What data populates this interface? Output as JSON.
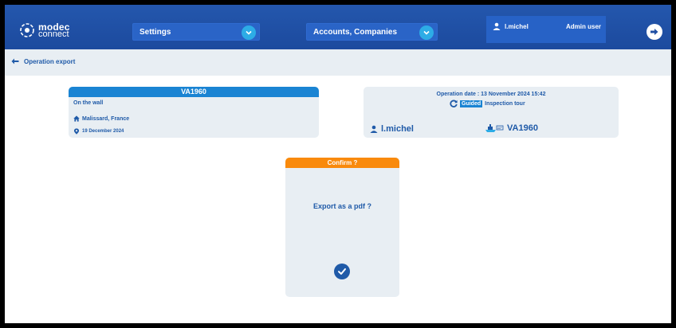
{
  "header": {
    "logo": {
      "top": "modec",
      "bottom": "connect"
    },
    "settings_select": "Settings",
    "accounts_select": "Accounts, Companies",
    "user": {
      "name": "l.michel",
      "role": "Admin user"
    }
  },
  "subbar": {
    "back_label": "Operation export"
  },
  "card1": {
    "title": "VA1960",
    "location_desc": "On the wall",
    "place": "Malissard, France",
    "date": "19 December 2024"
  },
  "card2": {
    "operation_date": "Operation date : 13 November 2024 15:42",
    "guided_badge": "Guided",
    "tour_type": "Inspection tour",
    "user": "l.michel",
    "boat_id": "VA1960"
  },
  "confirm": {
    "title": "Confirm ?",
    "question": "Export as a pdf ?"
  },
  "colors": {
    "header": "#1f4fa3",
    "accent_blue": "#1a84d3",
    "text_blue": "#1f5aa8",
    "orange": "#f98a0c",
    "panel": "#e8eef3"
  }
}
